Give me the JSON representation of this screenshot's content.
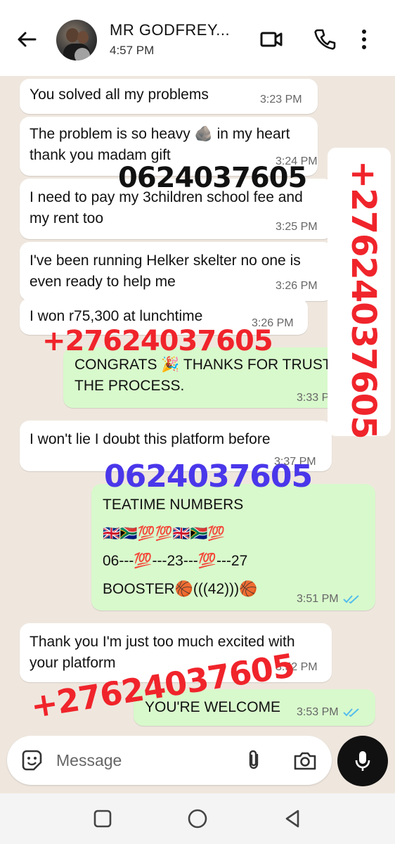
{
  "header": {
    "contact_name": "MR GODFREY...",
    "status": "4:57 PM"
  },
  "messages": [
    {
      "text": "You solved all my problems",
      "time": "3:23 PM"
    },
    {
      "text": "The problem is so heavy 🪨 in my heart thank you madam gift",
      "time": "3:24 PM"
    },
    {
      "text": "I need to pay my 3children school fee and my rent too",
      "time": "3:25 PM"
    },
    {
      "text": "I've been running Helker skelter no one is even ready to help me",
      "time": "3:26 PM"
    },
    {
      "text": "I won r75,300 at lunchtime",
      "time": "3:26 PM"
    },
    {
      "text": "CONGRATS 🎉 THANKS  FOR TRUSTING THE PROCESS.",
      "time": "3:33 PM"
    },
    {
      "text": "I won't lie I doubt this platform before",
      "time": "3:37 PM"
    },
    {
      "line1": "TEATIME NUMBERS",
      "line2": "🇬🇧🇿🇦💯💯🇬🇧🇿🇦💯",
      "line3": "06---💯---23---💯---27",
      "line4": "BOOSTER🏀(((42)))🏀",
      "time": "3:51 PM"
    },
    {
      "text": "Thank you I'm just too much excited with your platform",
      "time": "3:52 PM"
    },
    {
      "text": "YOU'RE WELCOME",
      "time": "3:53 PM"
    }
  ],
  "watermarks": {
    "black": "0624037605",
    "red_1": "+27624037605",
    "blue": "0624037605",
    "red_2": "+27624037605",
    "vertical": "+27624037605"
  },
  "composer": {
    "placeholder": "Message"
  },
  "colors": {
    "chat_bg": "#efe7de",
    "incoming": "#ffffff",
    "outgoing": "#d8f9cc",
    "read_ticks": "#53bdeb",
    "watermark_red": "#f0242b",
    "watermark_blue": "#4a37ea"
  }
}
